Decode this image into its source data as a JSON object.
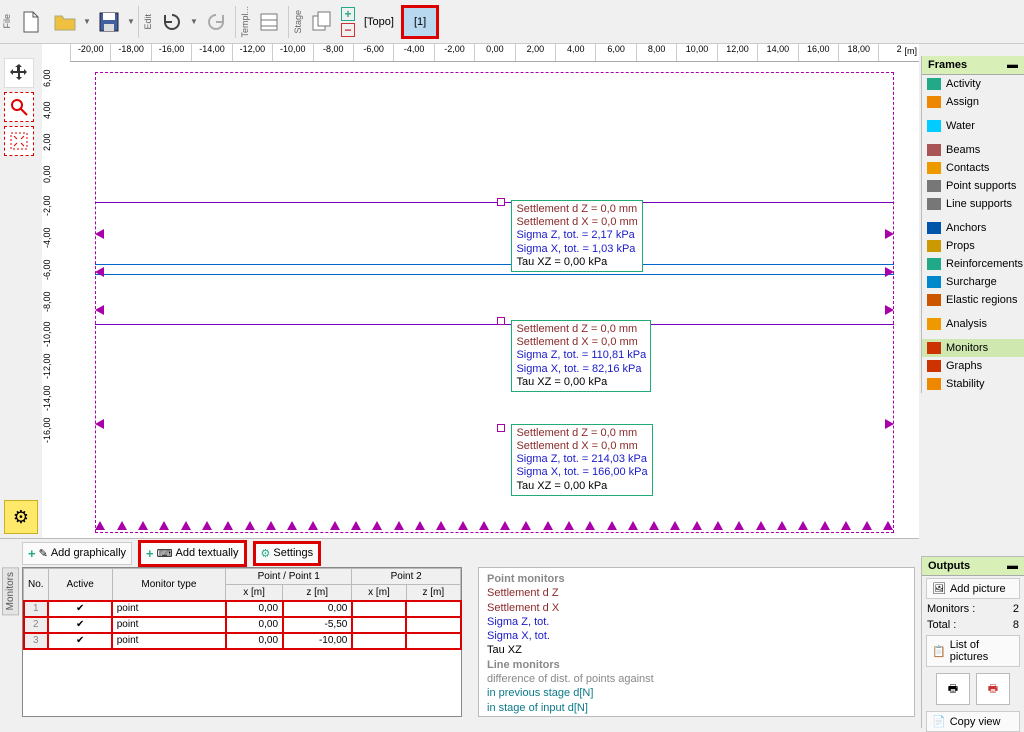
{
  "toolbar": {
    "file": "File",
    "edit": "Edit",
    "templ": "Templ...",
    "stage": "Stage",
    "topo": "[Topo]",
    "stage1": "[1]"
  },
  "ruler_units": "[m]",
  "ruler_h": [
    "-20,00",
    "-18,00",
    "-16,00",
    "-14,00",
    "-12,00",
    "-10,00",
    "-8,00",
    "-6,00",
    "-4,00",
    "-2,00",
    "0,00",
    "2,00",
    "4,00",
    "6,00",
    "8,00",
    "10,00",
    "12,00",
    "14,00",
    "16,00",
    "18,00",
    "2"
  ],
  "ruler_v": [
    "6,00",
    "4,00",
    "2,00",
    "0,00",
    "-2,00",
    "-4,00",
    "-6,00",
    "-8,00",
    "-10,00",
    "-12,00",
    "-14,00",
    "-16,00"
  ],
  "labels": [
    {
      "s1": "Settlement d Z = 0,0 mm",
      "s2": "Settlement d X = 0,0 mm",
      "s3": "Sigma Z, tot. = 2,17 kPa",
      "s4": "Sigma X, tot. = 1,03 kPa",
      "s5": "Tau XZ = 0,00 kPa"
    },
    {
      "s1": "Settlement d Z = 0,0 mm",
      "s2": "Settlement d X = 0,0 mm",
      "s3": "Sigma Z, tot. = 110,81 kPa",
      "s4": "Sigma X, tot. = 82,16 kPa",
      "s5": "Tau XZ = 0,00 kPa"
    },
    {
      "s1": "Settlement d Z = 0,0 mm",
      "s2": "Settlement d X = 0,0 mm",
      "s3": "Sigma Z, tot. = 214,03 kPa",
      "s4": "Sigma X, tot. = 166,00 kPa",
      "s5": "Tau XZ = 0,00 kPa"
    }
  ],
  "bp": {
    "add_graph": "Add graphically",
    "add_text": "Add textually",
    "settings": "Settings",
    "cols": {
      "no": "No.",
      "active": "Active",
      "type": "Monitor type",
      "pp1": "Point / Point 1",
      "p2": "Point 2",
      "xm": "x [m]",
      "zm": "z [m]"
    },
    "rows": [
      {
        "n": "1",
        "type": "point",
        "x": "0,00",
        "z": "0,00"
      },
      {
        "n": "2",
        "type": "point",
        "x": "0,00",
        "z": "-5,50"
      },
      {
        "n": "3",
        "type": "point",
        "x": "0,00",
        "z": "-10,00"
      }
    ],
    "vtab": "Monitors"
  },
  "info": {
    "h1": "Point monitors",
    "l1": "Settlement d Z",
    "l2": "Settlement d X",
    "l3": "Sigma Z, tot.",
    "l4": "Sigma X, tot.",
    "l5": "Tau XZ",
    "h2": "Line monitors",
    "l6": "difference of dist. of points against",
    "l7": "in previous stage d[N]",
    "l8": "in stage of input d[N]"
  },
  "frames": {
    "title": "Frames",
    "items": [
      "Activity",
      "Assign",
      "Water",
      "Beams",
      "Contacts",
      "Point supports",
      "Line supports",
      "Anchors",
      "Props",
      "Reinforcements",
      "Surcharge",
      "Elastic regions",
      "Analysis",
      "Monitors",
      "Graphs",
      "Stability"
    ]
  },
  "outputs": {
    "title": "Outputs",
    "add_pic": "Add picture",
    "mon_label": "Monitors :",
    "mon_val": "2",
    "tot_label": "Total :",
    "tot_val": "8",
    "list": "List of pictures",
    "copy": "Copy view"
  }
}
